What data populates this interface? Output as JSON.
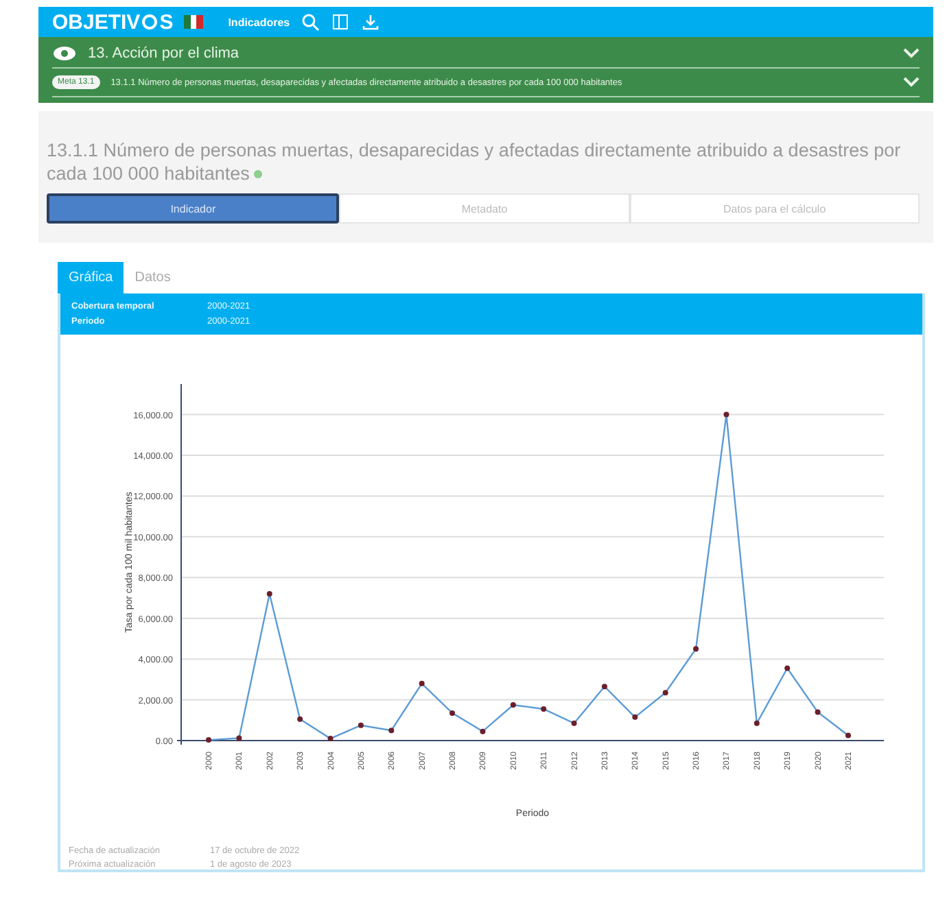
{
  "header": {
    "logo_left": "OBJETIV",
    "logo_right": "S",
    "nav_link": "Indicadores"
  },
  "goal": {
    "title": "13. Acción por el clima",
    "expanded": false
  },
  "target": {
    "badge": "Meta 13.1",
    "title": "13.1.1 Número de personas muertas, desaparecidas y afectadas directamente atribuido a desastres por cada 100 000 habitantes",
    "expanded": false
  },
  "indicator": {
    "title": "13.1.1 Número de personas muertas, desaparecidas y afectadas directamente atribuido a desastres por cada 100 000 habitantes"
  },
  "tabs": [
    {
      "label": "Indicador",
      "selected": true
    },
    {
      "label": "Metadato",
      "selected": false
    },
    {
      "label": "Datos para el cálculo",
      "selected": false
    }
  ],
  "view_tabs": [
    {
      "label": "Gráfica",
      "selected": true
    },
    {
      "label": "Datos",
      "selected": false
    }
  ],
  "info": [
    {
      "label": "Cobertura temporal",
      "value": "2000-2021"
    },
    {
      "label": "Periodo",
      "value": "2000-2021"
    }
  ],
  "chart_data": {
    "type": "line",
    "xlabel": "Periodo",
    "ylabel": "Tasa por cada 100 mil habitantes",
    "categories": [
      "2000",
      "2001",
      "2002",
      "2003",
      "2004",
      "2005",
      "2006",
      "2007",
      "2008",
      "2009",
      "2010",
      "2011",
      "2012",
      "2013",
      "2014",
      "2015",
      "2016",
      "2017",
      "2018",
      "2019",
      "2020",
      "2021"
    ],
    "grid": true,
    "ylim": [
      0,
      17500
    ],
    "series": [
      {
        "color": "#5b9bd5",
        "marker": true,
        "values": [
          30,
          120,
          7200,
          1050,
          100,
          750,
          500,
          2800,
          1350,
          450,
          1750,
          1550,
          850,
          2650,
          1150,
          2350,
          4500,
          16000,
          850,
          3550,
          1400,
          250
        ]
      }
    ],
    "yticks": [
      {
        "value": 0,
        "label": "0.00"
      },
      {
        "value": 2000,
        "label": "2,000.00"
      },
      {
        "value": 4000,
        "label": "4,000.00"
      },
      {
        "value": 6000,
        "label": "6,000.00"
      },
      {
        "value": 8000,
        "label": "8,000.00"
      },
      {
        "value": 10000,
        "label": "10,000.00"
      },
      {
        "value": 12000,
        "label": "12,000.00"
      },
      {
        "value": 14000,
        "label": "14,000.00"
      },
      {
        "value": 16000,
        "label": "16,000.00"
      }
    ]
  },
  "footer": [
    {
      "label": "Fecha de actualización",
      "value": "17 de octubre de 2022"
    },
    {
      "label": "Próxima actualización",
      "value": "1 de agosto de 2023"
    }
  ]
}
